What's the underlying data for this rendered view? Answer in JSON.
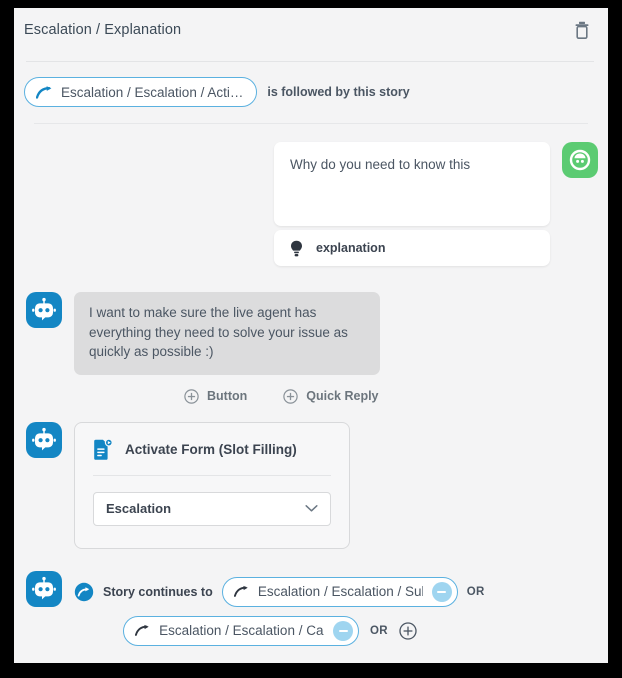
{
  "header": {
    "title": "Escalation / Explanation",
    "delete_icon": "trash-icon"
  },
  "follow_row": {
    "chip_label": "Escalation / Escalation / Acti…",
    "chip_icon": "curved-arrow-icon",
    "text": "is followed by this story"
  },
  "user_message": {
    "avatar_icon": "user-face-icon",
    "text": "Why do you need to know this",
    "intent": {
      "icon": "lightbulb-icon",
      "label": "explanation"
    }
  },
  "bot_message": {
    "avatar_icon": "robot-icon",
    "text": "I want to make sure the live agent has everything they need to solve your issue as quickly as possible :)",
    "actions": [
      {
        "icon": "plus-circle-icon",
        "label": "Button"
      },
      {
        "icon": "plus-circle-icon",
        "label": "Quick Reply"
      }
    ]
  },
  "form_card": {
    "avatar_icon": "robot-icon",
    "icon": "document-form-icon",
    "title": "Activate Form (Slot Filling)",
    "select": {
      "value": "Escalation",
      "chevron_icon": "chevron-down-icon"
    }
  },
  "continues": {
    "avatar_icon": "robot-icon",
    "icon": "arrow-circle-icon",
    "label": "Story continues to",
    "chips": [
      {
        "icon": "curved-arrow-icon",
        "label": "Escalation / Escalation / Sub…",
        "remove_icon": "minus-circle-icon",
        "or": "OR"
      },
      {
        "icon": "curved-arrow-icon",
        "label": "Escalation / Escalation / Can…",
        "remove_icon": "minus-circle-icon",
        "or": "OR"
      }
    ],
    "add_icon": "plus-circle-icon"
  },
  "colors": {
    "accent_blue": "#1386c4",
    "chip_border": "#5bb1e0",
    "user_green": "#5bcb72",
    "bot_bubble": "#dcdcdd",
    "canvas": "#f4f4f5"
  }
}
